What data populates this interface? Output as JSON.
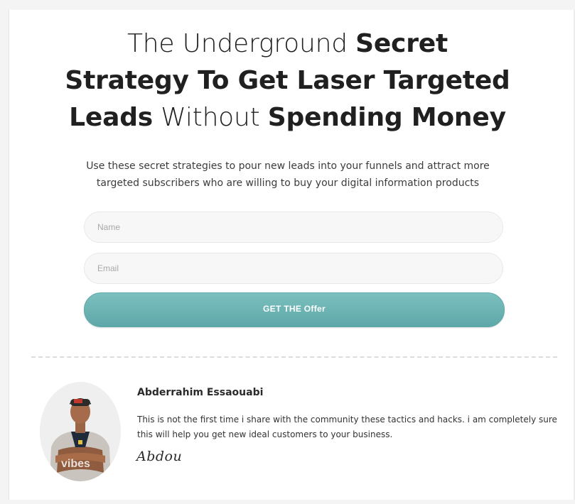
{
  "headline": {
    "line1_light": "The Underground ",
    "line1_bold": "Secret",
    "line2_bold": "Strategy To Get Laser Targeted",
    "line3_bold_a": "Leads",
    "line3_light": " Without ",
    "line3_bold_b": "Spending Money"
  },
  "subtext": "Use these secret strategies to pour new leads into your funnels and attract more targeted subscribers who are willing to buy your digital information products",
  "form": {
    "name_placeholder": "Name",
    "email_placeholder": "Email",
    "submit_label": "GET THE Offer"
  },
  "author": {
    "name": "Abderrahim Essaouabi",
    "bio": "This is not the first time i share with the community these tactics and hacks. i am completely sure this will help you get new ideal customers to your business.",
    "signature": "Abdou"
  },
  "colors": {
    "accent": "#6bb3b3",
    "text": "#202020"
  }
}
